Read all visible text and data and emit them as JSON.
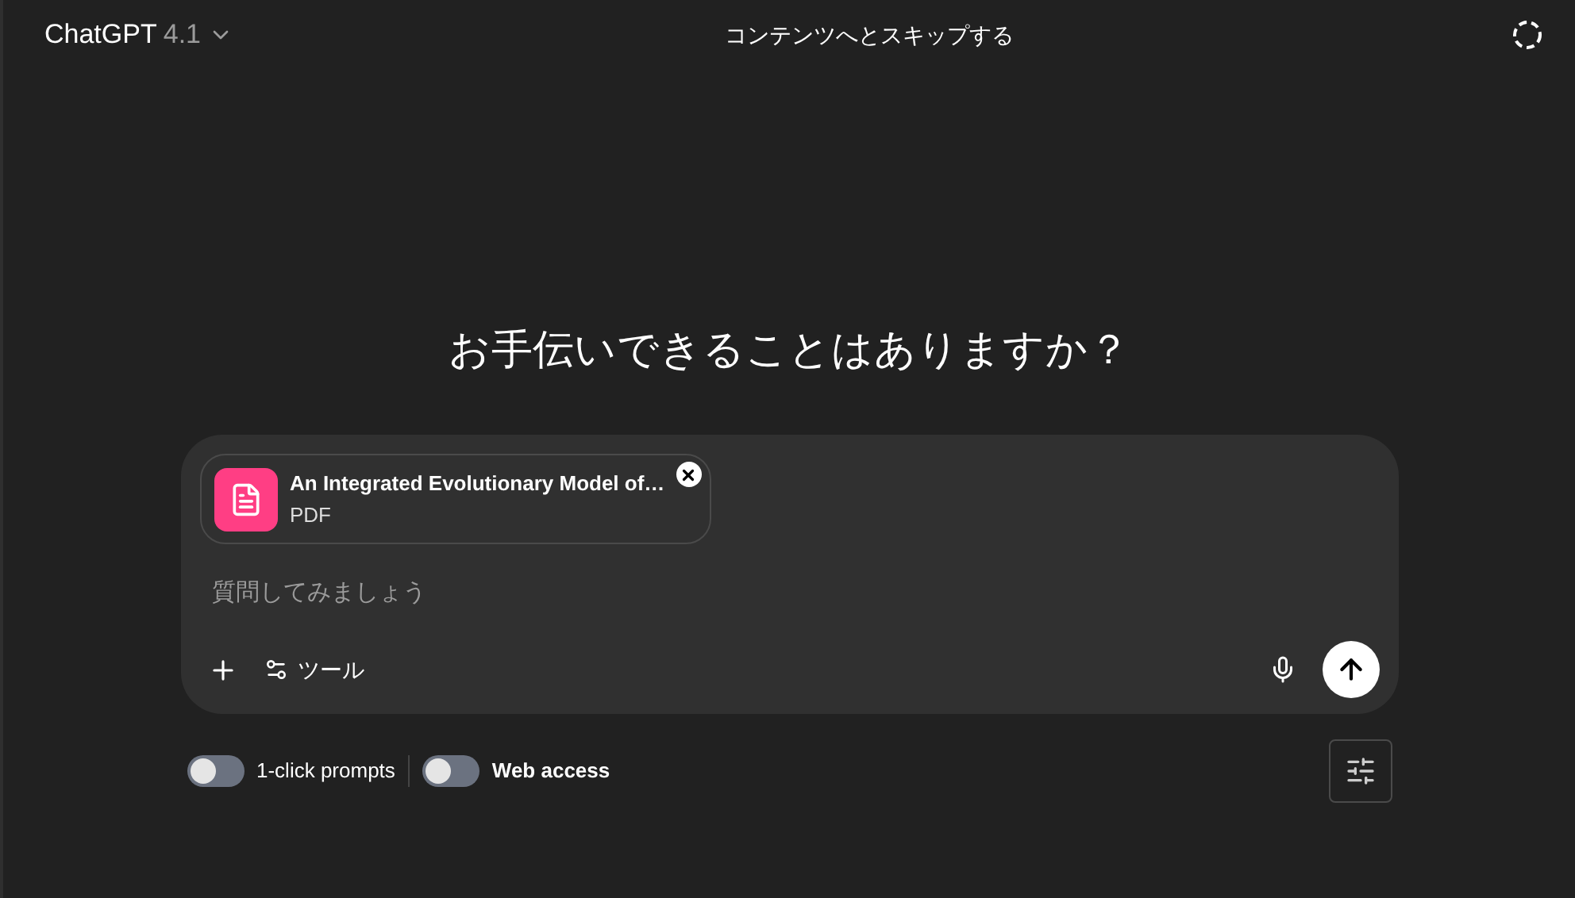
{
  "header": {
    "model": "ChatGPT",
    "version": "4.1",
    "skip_link": "コンテンツへとスキップする"
  },
  "heading": "お手伝いできることはありますか？",
  "composer": {
    "attachment": {
      "title": "An Integrated Evolutionary Model of…",
      "type": "PDF"
    },
    "placeholder": "質問してみましょう",
    "tools_label": "ツール"
  },
  "toggles": [
    {
      "label": "1-click prompts",
      "on": false,
      "bold": false
    },
    {
      "label": "Web access",
      "on": false,
      "bold": true
    }
  ]
}
